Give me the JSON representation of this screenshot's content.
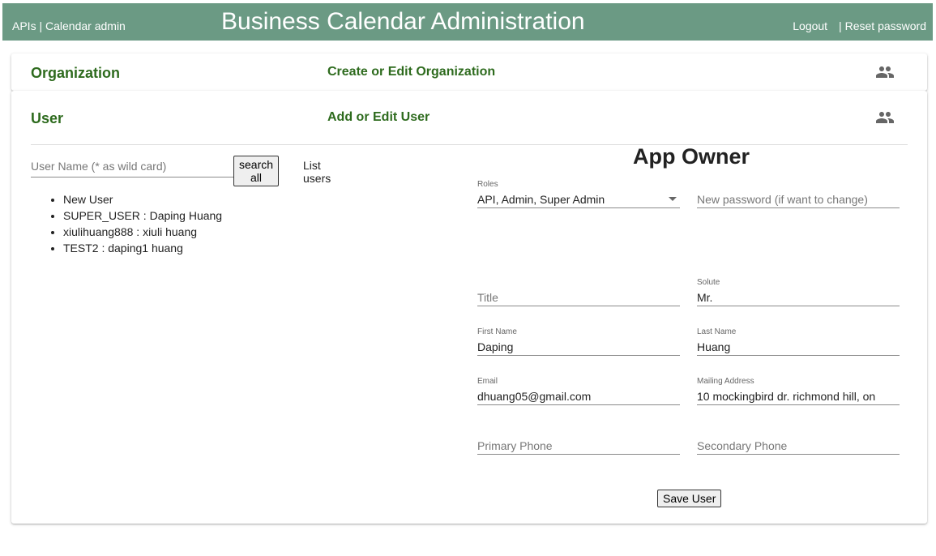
{
  "header": {
    "apis_link": "APIs",
    "calendar_admin_link": "Calendar admin",
    "title": "Business Calendar Administration",
    "logout": "Logout",
    "reset_password": "Reset password"
  },
  "organization_panel": {
    "title": "Organization",
    "subtitle": "Create or Edit Organization",
    "icon": "people-icon"
  },
  "user_panel": {
    "title": "User",
    "subtitle": "Add or Edit User",
    "icon": "people-icon",
    "search": {
      "placeholder": "User Name (* as wild card)",
      "value": "",
      "button": "search all",
      "list_label": "List users"
    },
    "users": [
      "New User",
      "SUPER_USER : Daping   Huang",
      "xiulihuang888 : xiuli   huang",
      "TEST2 : daping1   huang"
    ],
    "form": {
      "heading": "App Owner",
      "roles": {
        "label": "Roles",
        "value": "API, Admin, Super Admin"
      },
      "new_password": {
        "placeholder": "New password (if want to change)",
        "value": ""
      },
      "title": {
        "placeholder": "Title",
        "value": ""
      },
      "solute": {
        "label": "Solute",
        "value": "Mr."
      },
      "first_name": {
        "label": "First Name",
        "value": "Daping"
      },
      "last_name": {
        "label": "Last Name",
        "value": "Huang"
      },
      "email": {
        "label": "Email",
        "value": "dhuang05@gmail.com"
      },
      "mailing_address": {
        "label": "Mailing Address",
        "value": "10 mockingbird dr. richmond hill, on"
      },
      "primary_phone": {
        "placeholder": "Primary Phone",
        "value": ""
      },
      "secondary_phone": {
        "placeholder": "Secondary Phone",
        "value": ""
      },
      "save_button": "Save User"
    }
  },
  "colors": {
    "header_bg": "#6b9a84",
    "accent_green": "#2e6b1e"
  }
}
